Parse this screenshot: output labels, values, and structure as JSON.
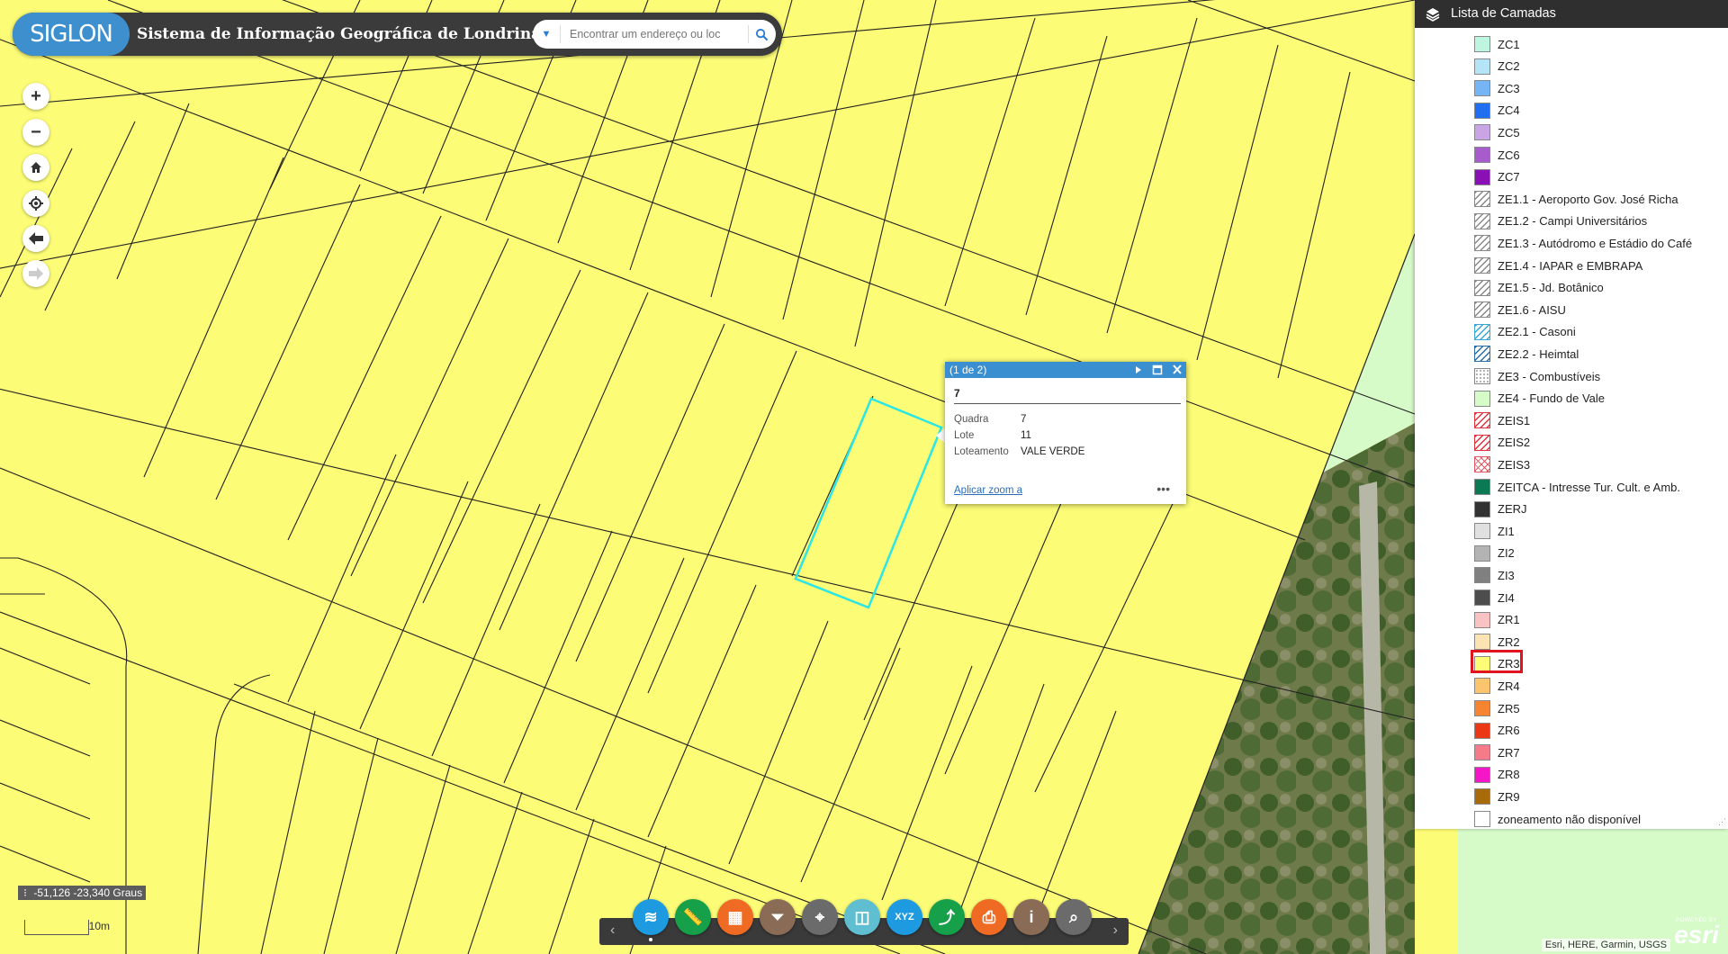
{
  "app": {
    "logo_text": "SIGLON",
    "title": "Sistema de Informação Geográfica de Londrina"
  },
  "search": {
    "placeholder": "Encontrar um endereço ou loc"
  },
  "map_controls": [
    "zoom-in",
    "zoom-out",
    "home",
    "locate",
    "back",
    "forward"
  ],
  "status": {
    "coordinates": "-51,126 -23,340 Graus",
    "scale_label": "10m",
    "attribution": "Esri, HERE, Garmin, USGS",
    "esri_small": "POWERED BY",
    "esri_logo": "esri"
  },
  "popup": {
    "header": "(1 de 2)",
    "title": "7",
    "fields": [
      {
        "key": "Quadra",
        "value": "7"
      },
      {
        "key": "Lote",
        "value": "11"
      },
      {
        "key": "Loteamento",
        "value": "VALE VERDE"
      }
    ],
    "zoom_link": "Aplicar zoom a",
    "more": "•••"
  },
  "layer_list": {
    "title": "Lista de Camadas",
    "selected": "ZR3",
    "items": [
      {
        "label": "ZC1",
        "color": "#bdf5e0",
        "pattern": "solid"
      },
      {
        "label": "ZC2",
        "color": "#b5e4f7",
        "pattern": "solid"
      },
      {
        "label": "ZC3",
        "color": "#76b5f5",
        "pattern": "solid"
      },
      {
        "label": "ZC4",
        "color": "#1f6ff0",
        "pattern": "solid"
      },
      {
        "label": "ZC5",
        "color": "#c9a5e6",
        "pattern": "solid"
      },
      {
        "label": "ZC6",
        "color": "#a65ccc",
        "pattern": "solid"
      },
      {
        "label": "ZC7",
        "color": "#8a0fb4",
        "pattern": "solid"
      },
      {
        "label": "ZE1.1 - Aeroporto Gov. José Richa",
        "color": "#888888",
        "pattern": "hatch"
      },
      {
        "label": "ZE1.2 - Campi Universitários",
        "color": "#888888",
        "pattern": "hatch"
      },
      {
        "label": "ZE1.3 - Autódromo e Estádio do Café",
        "color": "#888888",
        "pattern": "hatch"
      },
      {
        "label": "ZE1.4 - IAPAR e EMBRAPA",
        "color": "#888888",
        "pattern": "hatch"
      },
      {
        "label": "ZE1.5 - Jd. Botânico",
        "color": "#888888",
        "pattern": "hatch"
      },
      {
        "label": "ZE1.6 - AISU",
        "color": "#888888",
        "pattern": "hatch"
      },
      {
        "label": "ZE2.1 - Casoni",
        "color": "#3aa6d8",
        "pattern": "hatch"
      },
      {
        "label": "ZE2.2 - Heimtal",
        "color": "#2a6ea8",
        "pattern": "hatch"
      },
      {
        "label": "ZE3 - Combustíveis",
        "color": "#999999",
        "pattern": "dots"
      },
      {
        "label": "ZE4 - Fundo de Vale",
        "color": "#d6fac8",
        "pattern": "solid"
      },
      {
        "label": "ZEIS1",
        "color": "#e0323c",
        "pattern": "hatch"
      },
      {
        "label": "ZEIS2",
        "color": "#e0323c",
        "pattern": "hatch"
      },
      {
        "label": "ZEIS3",
        "color": "#e05a64",
        "pattern": "cross"
      },
      {
        "label": "ZEITCA - Intresse Tur. Cult. e Amb.",
        "color": "#0a7a55",
        "pattern": "solid"
      },
      {
        "label": "ZERJ",
        "color": "#333333",
        "pattern": "solid"
      },
      {
        "label": "ZI1",
        "color": "#e0e0e0",
        "pattern": "solid"
      },
      {
        "label": "ZI2",
        "color": "#b3b3b3",
        "pattern": "solid"
      },
      {
        "label": "ZI3",
        "color": "#808080",
        "pattern": "solid"
      },
      {
        "label": "ZI4",
        "color": "#4d4d4d",
        "pattern": "solid"
      },
      {
        "label": "ZR1",
        "color": "#f9c3c3",
        "pattern": "solid"
      },
      {
        "label": "ZR2",
        "color": "#fbe3b4",
        "pattern": "solid"
      },
      {
        "label": "ZR3",
        "color": "#fcfc76",
        "pattern": "solid"
      },
      {
        "label": "ZR4",
        "color": "#fbc56e",
        "pattern": "solid"
      },
      {
        "label": "ZR5",
        "color": "#f78431",
        "pattern": "solid"
      },
      {
        "label": "ZR6",
        "color": "#ec3714",
        "pattern": "solid"
      },
      {
        "label": "ZR7",
        "color": "#f57b8a",
        "pattern": "solid"
      },
      {
        "label": "ZR8",
        "color": "#f516c8",
        "pattern": "solid"
      },
      {
        "label": "ZR9",
        "color": "#a96b0a",
        "pattern": "solid"
      },
      {
        "label": "zoneamento não disponível",
        "color": "#ffffff",
        "pattern": "solid"
      }
    ]
  },
  "toolbar": {
    "tools": [
      {
        "name": "layers",
        "color": "#1e9be0",
        "icon": "layers-icon"
      },
      {
        "name": "measure",
        "color": "#16a04a",
        "icon": "ruler-icon"
      },
      {
        "name": "basemap",
        "color": "#ef6a23",
        "icon": "grid-icon"
      },
      {
        "name": "filter",
        "color": "#8a6b55",
        "icon": "filter-icon"
      },
      {
        "name": "coordinates",
        "color": "#6b6b6b",
        "icon": "location-icon"
      },
      {
        "name": "swipe",
        "color": "#5fbfd0",
        "icon": "split-icon"
      },
      {
        "name": "xyz",
        "color": "#1e9be0",
        "icon": "xyz-icon"
      },
      {
        "name": "share",
        "color": "#16a04a",
        "icon": "share-icon"
      },
      {
        "name": "print",
        "color": "#ef6a23",
        "icon": "print-icon"
      },
      {
        "name": "about",
        "color": "#8a6b55",
        "icon": "info-icon"
      },
      {
        "name": "search-zoom",
        "color": "#6b6b6b",
        "icon": "zoom-search-icon"
      }
    ],
    "xyz_text": "XYZ"
  }
}
